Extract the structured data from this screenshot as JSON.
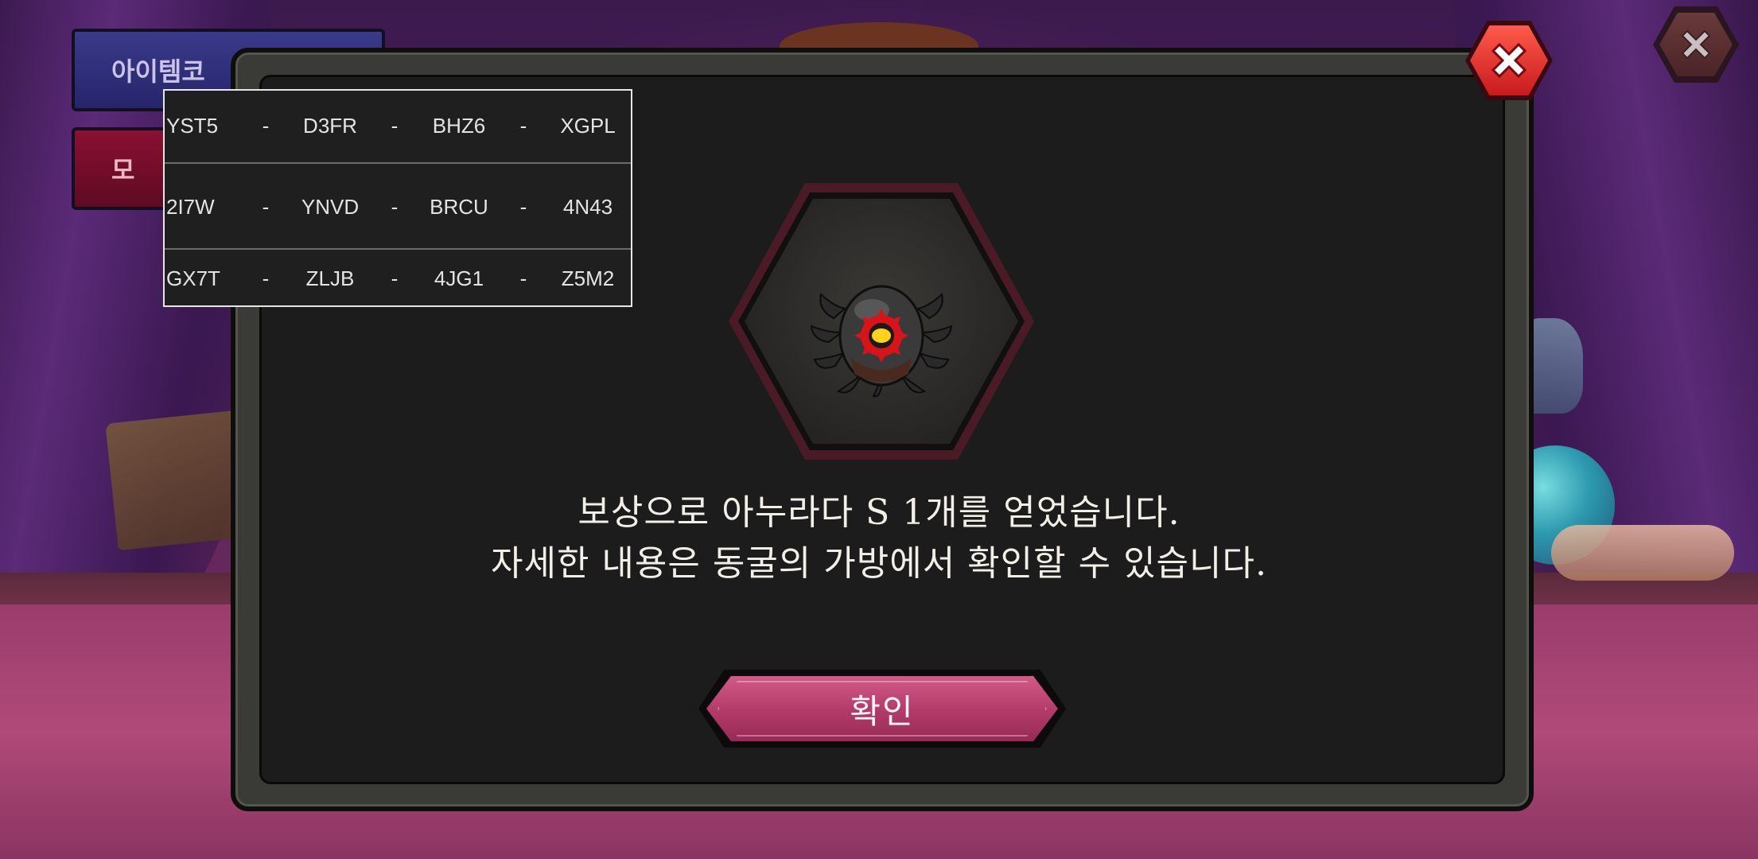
{
  "background_menu": {
    "item_code_label": "아이템코",
    "other_label": "모"
  },
  "reward": {
    "message_line1": "보상으로 아누라다 S 1개를 얻었습니다.",
    "message_line2": "자세한 내용은 동굴의 가방에서 확인할 수 있습니다.",
    "confirm_label": "확인"
  },
  "codes": {
    "separator": "-",
    "rows": [
      [
        "YST5",
        "D3FR",
        "BHZ6",
        "XGPL"
      ],
      [
        "2I7W",
        "YNVD",
        "BRCU",
        "4N43"
      ],
      [
        "GX7T",
        "ZLJB",
        "4JG1",
        "Z5M2"
      ]
    ]
  },
  "colors": {
    "confirm_button": "#b23a68",
    "close_button": "#e0302c",
    "modal_background": "#1c1c1c"
  },
  "icons": {
    "modal_close": "close-x-icon",
    "background_close": "close-x-icon",
    "reward_item": "anuradha-s-item-icon"
  }
}
